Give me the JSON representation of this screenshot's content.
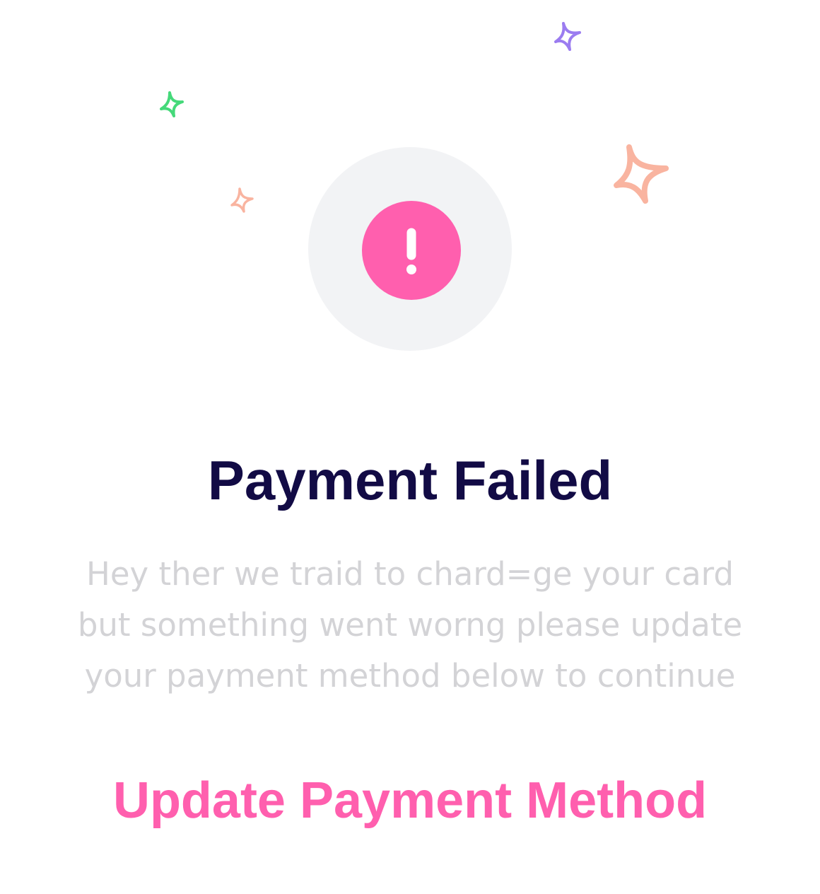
{
  "title": "Payment Failed",
  "message": "Hey ther we traid to chard=ge your card but something went worng please update your payment method below to continue",
  "action": {
    "label": "Update Payment Method"
  },
  "icons": {
    "status": "exclamation-icon",
    "decorations": [
      "sparkle-icon",
      "sparkle-icon",
      "sparkle-icon",
      "sparkle-icon"
    ]
  },
  "colors": {
    "accent": "#ff5fae",
    "title": "#120b45",
    "message": "#d3d3d6",
    "halo": "#f2f3f5",
    "sparkle_green": "#45d97a",
    "sparkle_purple": "#9b7cf0",
    "sparkle_peach": "#f9b4a0"
  }
}
